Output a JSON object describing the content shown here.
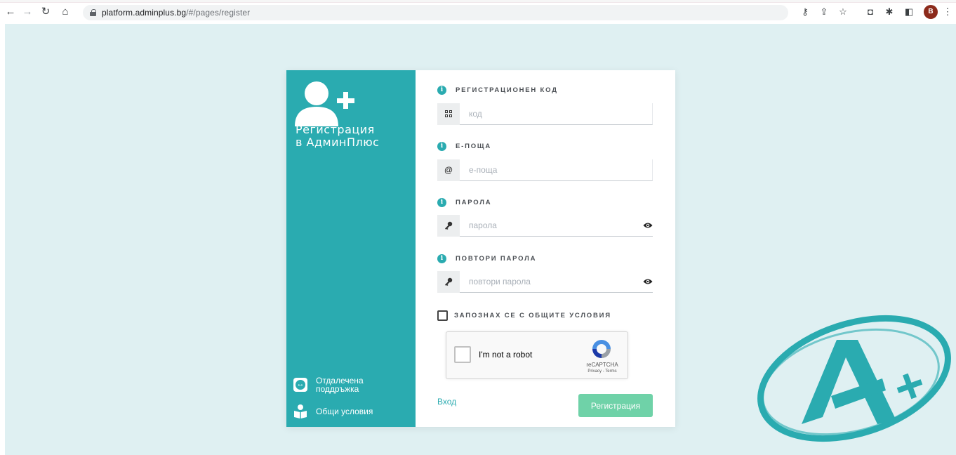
{
  "browser": {
    "url_domain": "platform.adminplus.bg",
    "url_path": "/#/pages/register",
    "profile_initial": "B",
    "nav_icons": [
      "back-arrow-icon",
      "forward-arrow-icon",
      "reload-icon",
      "home-icon"
    ],
    "toolbar_icons": [
      "key-icon",
      "share-icon",
      "star-icon",
      "extension-icon",
      "puzzle-icon",
      "sidepanel-icon",
      "more-icon"
    ]
  },
  "sidebar": {
    "title_line1": "Регистрация",
    "title_line2": "в АдминПлюс",
    "links": [
      {
        "label": "Отдалечена поддръжка",
        "icon": "remote-support-icon"
      },
      {
        "label": "Общи условия",
        "icon": "book-reader-icon"
      }
    ]
  },
  "form": {
    "code": {
      "label": "РЕГИСТРАЦИОНЕН КОД",
      "placeholder": "код",
      "icon": "qr-code-icon"
    },
    "email": {
      "label": "E-ПОЩА",
      "placeholder": "е-поща",
      "icon": "at-icon"
    },
    "password": {
      "label": "ПАРОЛА",
      "placeholder": "парола",
      "icon": "key-icon"
    },
    "repeat_password": {
      "label": "ПОВТОРИ ПАРОЛА",
      "placeholder": "повтори парола",
      "icon": "key-icon"
    },
    "terms_label": "ЗАПОЗНАХ СЕ С ОБЩИТЕ УСЛОВИЯ",
    "recaptcha": {
      "text": "I'm not a robot",
      "brand": "reCAPTCHA",
      "sub": "Privacy - Terms"
    },
    "login_link": "Вход",
    "submit_label": "Регистрация"
  },
  "colors": {
    "accent": "#2aabb0",
    "submit": "#6fd2a8",
    "background": "#dff0f2"
  }
}
